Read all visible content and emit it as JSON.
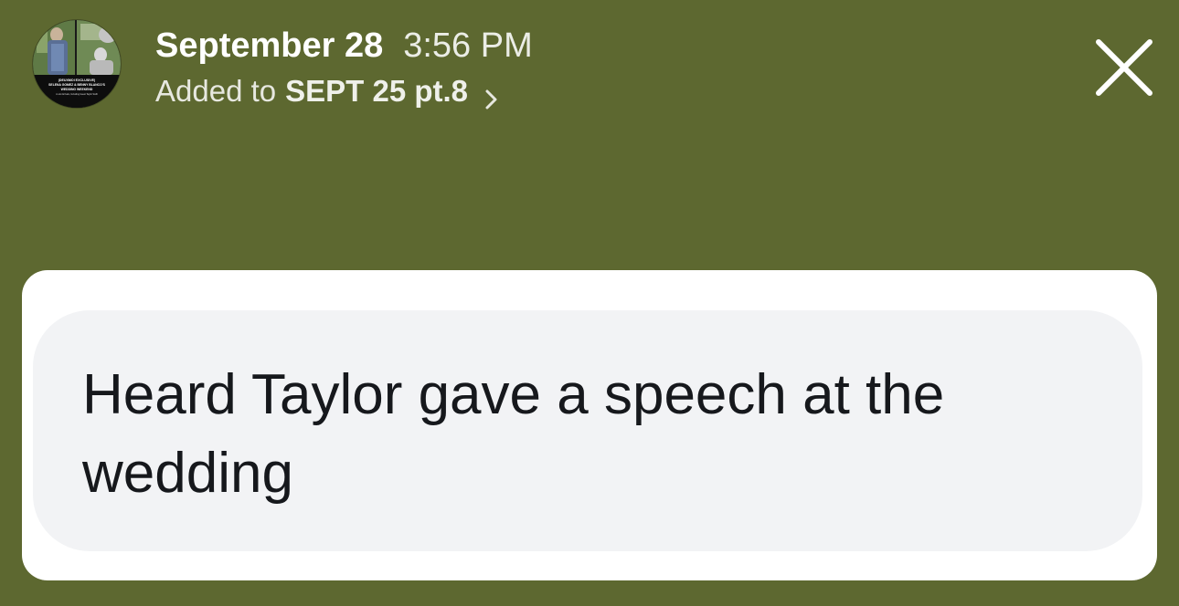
{
  "header": {
    "date": "September 28",
    "time": "3:56 PM",
    "added_prefix": "Added to",
    "collection": "SEPT 25 pt.8",
    "avatar_caption_line1": "(DEUXMOI EXCLUSIVE)",
    "avatar_caption_line2": "SELENA GOMEZ & BENNY BLANCO'S",
    "avatar_caption_line3": "WEDDING WEEKEND",
    "avatar_caption_line4": "A-List Arrivals, Including Guest Taylor Swift"
  },
  "icons": {
    "close": "close-icon",
    "chevron": "chevron-right-icon"
  },
  "message": {
    "text": "Heard Taylor gave a speech at the wedding"
  },
  "colors": {
    "background": "#5d6830",
    "card": "#ffffff",
    "bubble": "#f2f3f5",
    "text": "#16181c"
  }
}
